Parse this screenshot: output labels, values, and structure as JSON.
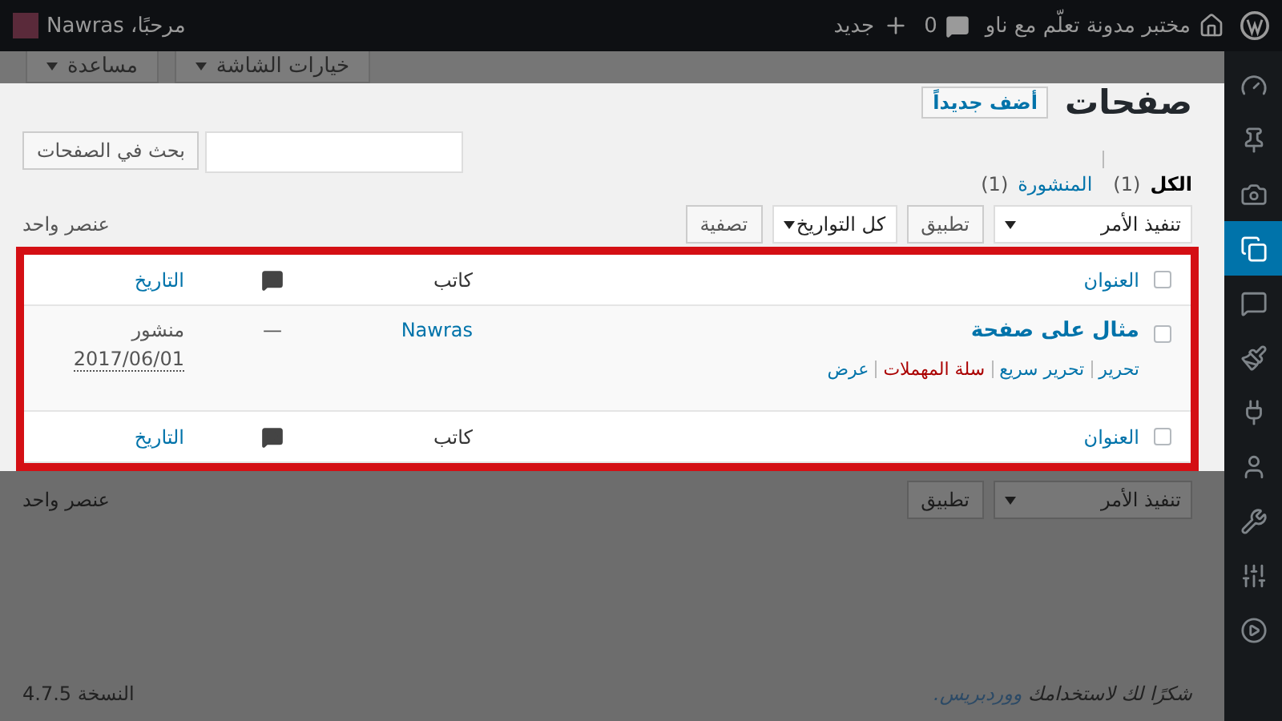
{
  "admin_bar": {
    "site_name": "مختبر مدونة تعلّم مع ناو",
    "comments_count": "0",
    "new_label": "جديد",
    "greeting": "مرحبًا، Nawras"
  },
  "screen_tabs": [
    {
      "label": "خيارات الشاشة"
    },
    {
      "label": "مساعدة"
    }
  ],
  "sidebar": {
    "items": [
      {
        "kind": "dashboard",
        "selected": false
      },
      {
        "kind": "posts",
        "selected": false
      },
      {
        "kind": "media",
        "selected": false
      },
      {
        "kind": "pages",
        "selected": true
      },
      {
        "kind": "comments",
        "selected": false
      },
      {
        "kind": "appearance",
        "selected": false
      },
      {
        "kind": "plugins",
        "selected": false
      },
      {
        "kind": "users",
        "selected": false
      },
      {
        "kind": "tools",
        "selected": false
      },
      {
        "kind": "settings",
        "selected": false
      },
      {
        "kind": "collapse",
        "selected": false
      }
    ]
  },
  "page": {
    "title": "صفحات",
    "add_new": "أضف جديداً"
  },
  "filters": [
    {
      "label": "الكل",
      "count": "(1)",
      "selected": true
    },
    {
      "label": "المنشورة",
      "count": "(1)",
      "selected": false
    }
  ],
  "search": {
    "button": "بحث في الصفحات"
  },
  "top_nav": {
    "bulk_action": "تنفيذ الأمر",
    "apply": "تطبيق",
    "dates": "كل التواريخ",
    "filter": "تصفية",
    "count": "عنصر واحد"
  },
  "table": {
    "header": {
      "title": "العنوان",
      "author": "كاتب",
      "date": "التاريخ",
      "checked": false
    },
    "rows": [
      {
        "title": "مثال على صفحة",
        "checked": false,
        "author": "Nawras",
        "comments": "—",
        "status": "منشور",
        "date": "2017/06/01",
        "actions": [
          {
            "label": "تحرير",
            "kind": "normal"
          },
          {
            "label": "تحرير سريع",
            "kind": "normal"
          },
          {
            "label": "سلة المهملات",
            "kind": "delete"
          },
          {
            "label": "عرض",
            "kind": "normal"
          }
        ]
      }
    ],
    "footer": {
      "title": "العنوان",
      "author": "كاتب",
      "date": "التاريخ",
      "checked": false
    }
  },
  "bottom_nav": {
    "bulk_action": "تنفيذ الأمر",
    "apply": "تطبيق",
    "count": "عنصر واحد"
  },
  "footer": {
    "thanks": "شكرًا لك لاستخدامك",
    "link": "ووردبريس.",
    "version": "النسخة 4.7.5"
  }
}
